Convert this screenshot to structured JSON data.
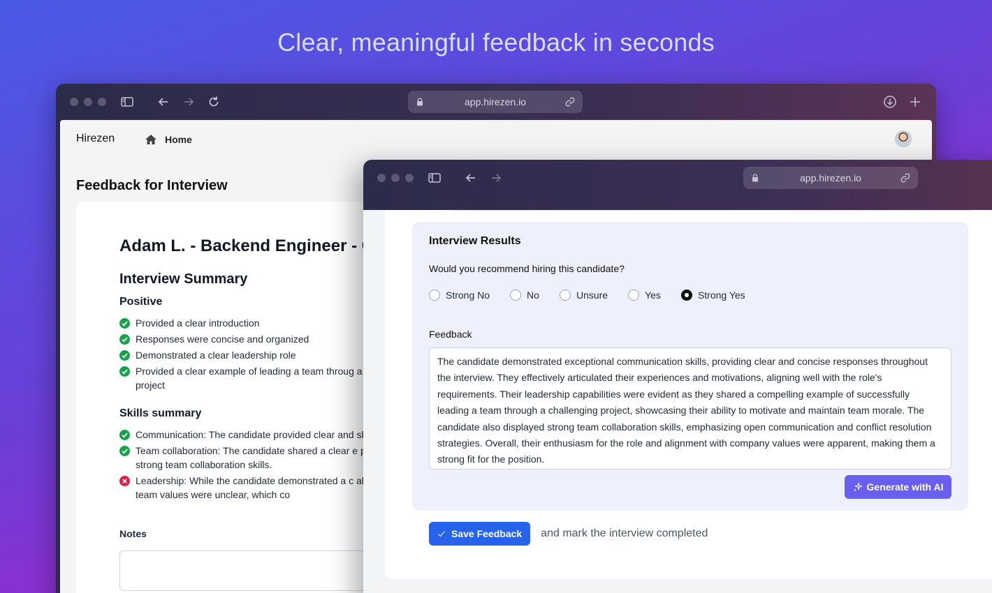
{
  "hero": {
    "title": "Clear, meaningful feedback in seconds"
  },
  "browser": {
    "url": "app.hirezen.io"
  },
  "app": {
    "brand": "Hirezen",
    "nav_home": "Home",
    "page_heading": "Feedback for Interview",
    "candidate_title": "Adam L. - Backend Engineer - C",
    "summary_title": "Interview Summary",
    "positive_title": "Positive",
    "positive_items": [
      "Provided a clear introduction",
      "Responses were concise and organized",
      "Demonstrated a clear leadership role",
      "Provided a clear example of leading a team throug a challenging project"
    ],
    "skills_title": "Skills summary",
    "skills_items": [
      {
        "text": "Communication: The candidate provided clear and skills.",
        "status": "positive"
      },
      {
        "text": "Team collaboration: The candidate shared a clear e project, indicating strong team collaboration skills.",
        "status": "positive"
      },
      {
        "text": "Leadership: While the candidate demonstrated a c alignment with team values were unclear, which co",
        "status": "negative"
      }
    ],
    "notes_label": "Notes"
  },
  "results": {
    "title": "Interview Results",
    "question": "Would you recommend hiring this candidate?",
    "options": [
      "Strong No",
      "No",
      "Unsure",
      "Yes",
      "Strong Yes"
    ],
    "selected": "Strong Yes",
    "feedback_label": "Feedback",
    "feedback_text": "The candidate demonstrated exceptional communication skills, providing clear and concise responses throughout the interview. They effectively articulated their experiences and motivations, aligning well with the role's requirements. Their leadership capabilities were evident as they shared a compelling example of successfully leading a team through a challenging project, showcasing their ability to motivate and maintain team morale. The candidate also displayed strong team collaboration skills, emphasizing open communication and conflict resolution strategies. Overall, their enthusiasm for the role and alignment with company values were apparent, making them a strong fit for the position.",
    "generate_label": "Generate with AI",
    "save_label": "Save Feedback",
    "save_note": "and mark the interview completed"
  },
  "colors": {
    "check_green": "#16a34a",
    "cross_red": "#e11d48",
    "save_blue": "#2563eb",
    "ai_purple": "#6a5ef0"
  }
}
